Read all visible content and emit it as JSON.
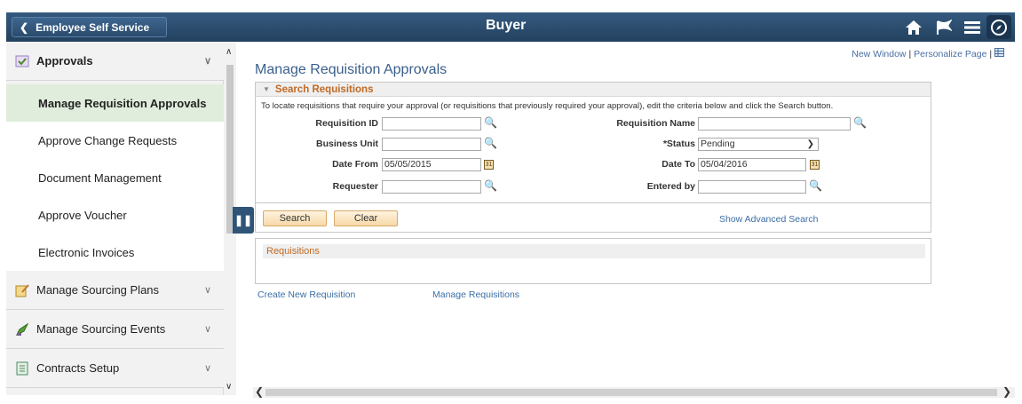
{
  "header": {
    "back_label": "Employee Self Service",
    "title": "Buyer",
    "icons": [
      "home-icon",
      "flag-icon",
      "menu-icon",
      "navigator-icon"
    ]
  },
  "sidebar": {
    "groups": [
      {
        "label": "Approvals",
        "icon": "approvals-icon",
        "expanded": true
      },
      {
        "label": "Manage Sourcing Plans",
        "icon": "sourcing-plans-icon"
      },
      {
        "label": "Manage Sourcing Events",
        "icon": "sourcing-events-icon"
      },
      {
        "label": "Contracts Setup",
        "icon": "contracts-icon"
      }
    ],
    "items": [
      {
        "label": "Manage Requisition Approvals",
        "active": true
      },
      {
        "label": "Approve Change Requests"
      },
      {
        "label": "Document Management"
      },
      {
        "label": "Approve Voucher"
      },
      {
        "label": "Electronic Invoices"
      }
    ]
  },
  "top_links": {
    "new_window": "New Window",
    "separator": "|",
    "personalize": "Personalize Page",
    "separator2": "|"
  },
  "main": {
    "page_title": "Manage Requisition Approvals",
    "search": {
      "section_title": "Search Requisitions",
      "instructions": "To locate requisitions that require your approval (or requisitions that previously required your approval), edit the criteria below and click the Search button.",
      "fields": {
        "requisition_id": {
          "label": "Requisition ID",
          "value": ""
        },
        "requisition_name": {
          "label": "Requisition Name",
          "value": ""
        },
        "business_unit": {
          "label": "Business Unit",
          "value": ""
        },
        "status": {
          "label": "*Status",
          "value": "Pending"
        },
        "date_from": {
          "label": "Date From",
          "value": "05/05/2015"
        },
        "date_to": {
          "label": "Date To",
          "value": "05/04/2016"
        },
        "requester": {
          "label": "Requester",
          "value": ""
        },
        "entered_by": {
          "label": "Entered by",
          "value": ""
        }
      },
      "search_button": "Search",
      "clear_button": "Clear",
      "advanced_link": "Show Advanced Search"
    },
    "requisitions_header": "Requisitions",
    "links": {
      "create": "Create New Requisition",
      "manage": "Manage Requisitions"
    }
  },
  "colors": {
    "header_bg": "#2b4a6b",
    "active_item_bg": "#e0eddc",
    "link": "#3a6ea5",
    "section_title": "#c06a25"
  }
}
